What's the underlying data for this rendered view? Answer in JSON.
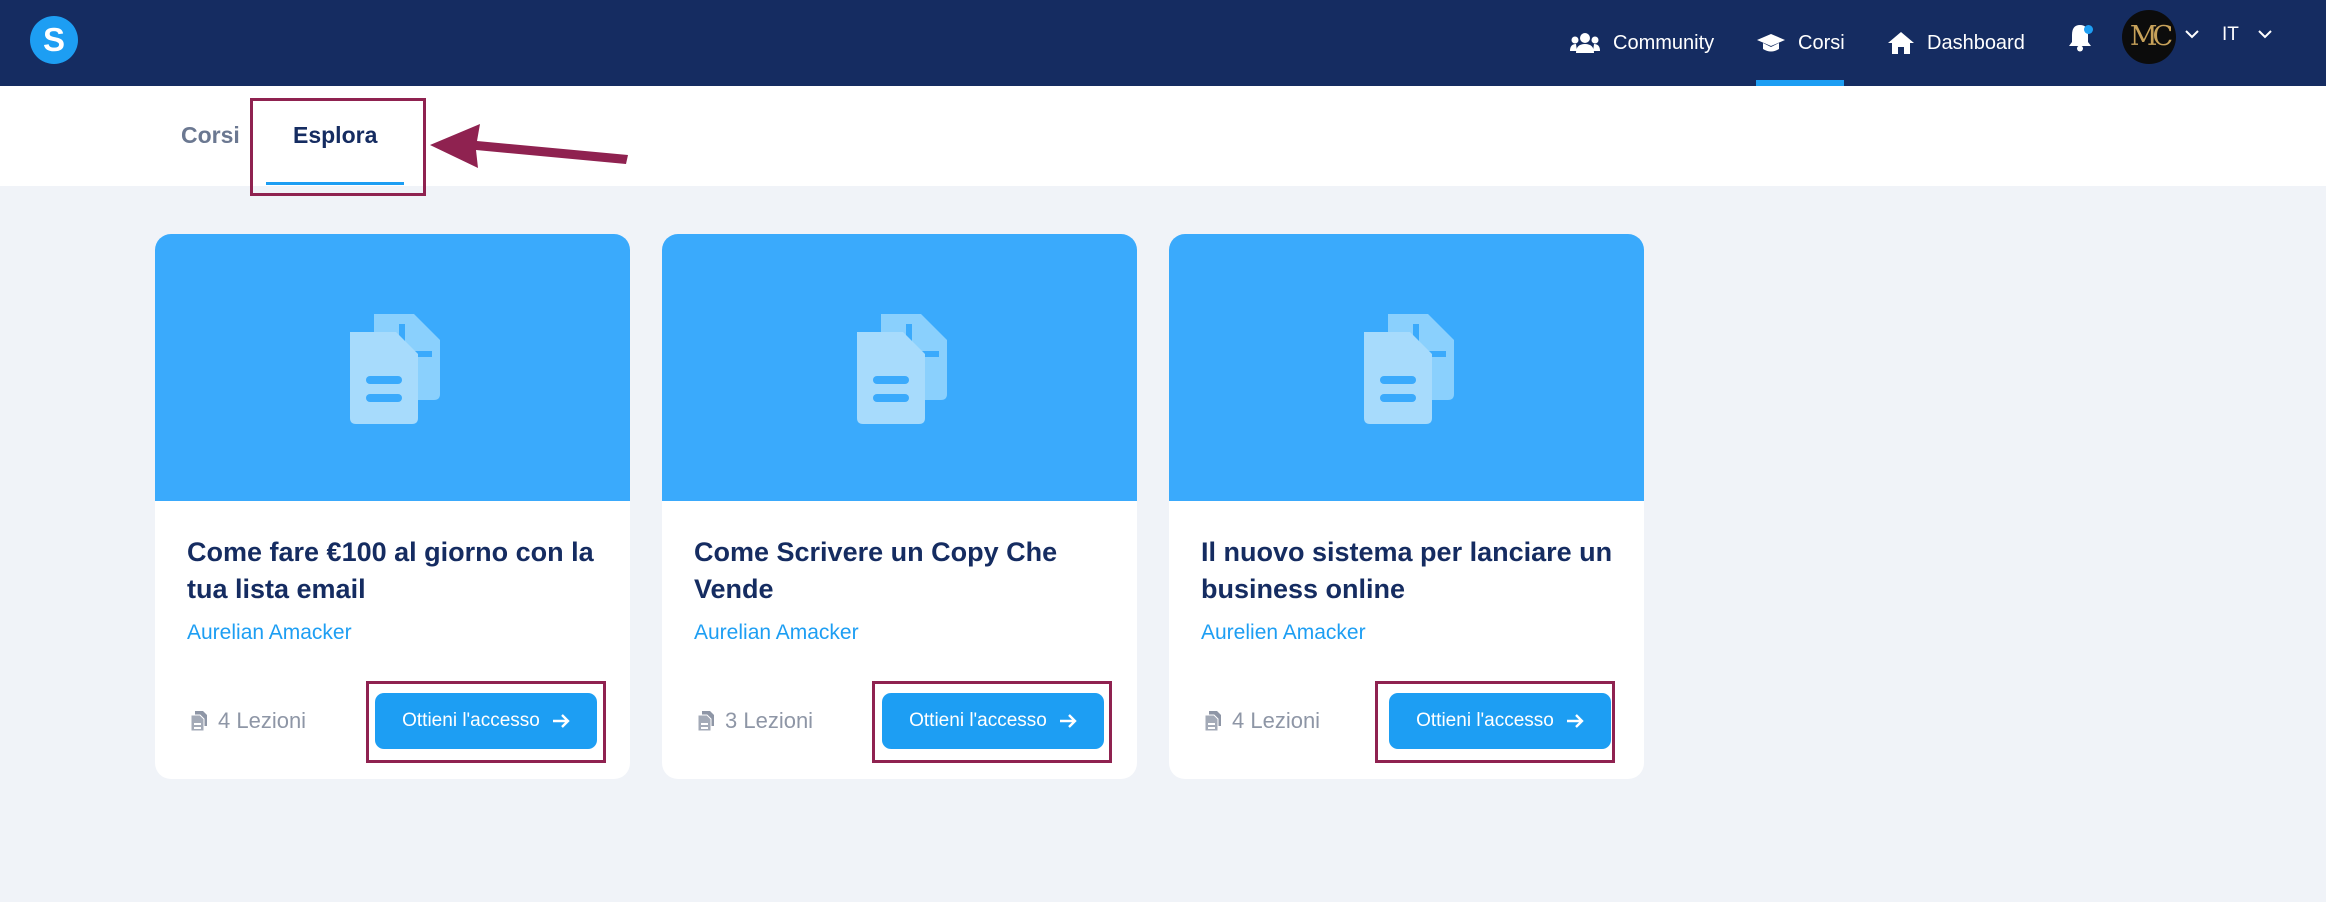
{
  "navbar": {
    "logo_letter": "S",
    "items": [
      {
        "label": "Community",
        "icon": "users-icon"
      },
      {
        "label": "Corsi",
        "icon": "graduation-cap-icon"
      },
      {
        "label": "Dashboard",
        "icon": "home-icon"
      }
    ],
    "active_item": "Corsi",
    "notifications_icon": "bell-icon",
    "avatar_initials": "MC",
    "language": "IT"
  },
  "tabs": {
    "items": [
      {
        "label": "Corsi"
      },
      {
        "label": "Esplora"
      }
    ],
    "active": "Esplora"
  },
  "courses": [
    {
      "title": "Come fare €100 al giorno con la tua lista email",
      "author": "Aurelian Amacker",
      "lessons": "4 Lezioni",
      "cta": "Ottieni l'accesso"
    },
    {
      "title": "Come Scrivere un Copy Che Vende",
      "author": "Aurelian Amacker",
      "lessons": "3 Lezioni",
      "cta": "Ottieni l'accesso"
    },
    {
      "title": "Il nuovo sistema per lanciare un business online",
      "author": "Aurelien Amacker",
      "lessons": "4 Lezioni",
      "cta": "Ottieni l'accesso"
    }
  ],
  "colors": {
    "navbar_bg": "#152c61",
    "accent": "#1d9ef3",
    "card_banner": "#3aaafc",
    "page_bg": "#f0f3f8",
    "annotation": "#8f2250"
  }
}
